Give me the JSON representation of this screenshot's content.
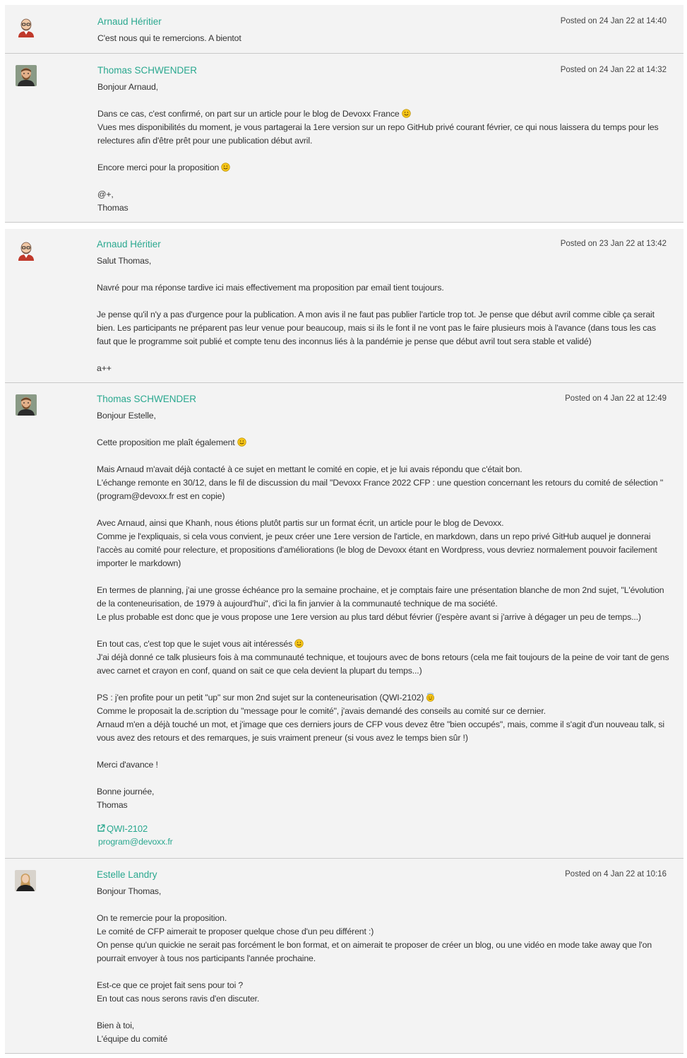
{
  "messages": [
    {
      "author": "Arnaud Héritier",
      "avatar_icon": "arnaud-avatar",
      "posted": "Posted on 24 Jan 22 at 14:40",
      "paragraphs": [
        "C'est nous qui te remercions. A bientot"
      ]
    },
    {
      "author": "Thomas SCHWENDER",
      "avatar_icon": "thomas-avatar",
      "posted": "Posted on 24 Jan 22 at 14:32",
      "paragraphs": [
        "Bonjour Arnaud,",
        "Dans ce cas, c'est confirmé, on part sur un article pour le blog de Devoxx France",
        "Vues mes disponibilités du moment, je vous partagerai la 1ere version sur un repo GitHub privé courant février, ce qui nous laissera du temps pour les relectures afin d'être prêt pour une publication début avril.",
        "Encore merci pour la proposition",
        "@+,\nThomas"
      ]
    },
    {
      "author": "Arnaud Héritier",
      "avatar_icon": "arnaud-avatar",
      "posted": "Posted on 23 Jan 22 at 13:42",
      "paragraphs": [
        "Salut Thomas,",
        "Navré pour ma réponse tardive ici mais effectivement ma proposition par email tient toujours.",
        "Je pense qu'il n'y a pas d'urgence pour la publication. A mon avis il ne faut pas publier l'article trop tot. Je pense que début avril comme cible ça serait bien. Les participants ne préparent pas leur venue pour beaucoup, mais si ils le font il ne vont pas le faire plusieurs mois à l'avance (dans tous les cas faut que le programme soit publié et compte tenu des inconnus liés à la pandémie je pense que début avril tout sera stable et validé)",
        "a++"
      ]
    },
    {
      "author": "Thomas SCHWENDER",
      "avatar_icon": "thomas-avatar",
      "posted": "Posted on 4 Jan 22 at 12:49",
      "paragraphs": [
        "Bonjour Estelle,",
        "Cette proposition me plaît également",
        "Mais Arnaud m'avait déjà contacté à ce sujet en mettant le comité en copie, et je lui avais répondu que c'était bon.\nL'échange remonte en 30/12, dans le fil de discussion du mail \"Devoxx France 2022 CFP : une question concernant les retours du comité de sélection \" (program@devoxx.fr est en copie)",
        "Avec Arnaud, ainsi que Khanh, nous étions plutôt partis sur un format écrit, un article pour le blog de Devoxx.\nComme je l'expliquais, si cela vous convient, je peux créer une 1ere version de l'article, en markdown, dans un repo privé GitHub auquel je donnerai l'accès au comité pour relecture, et propositions d'améliorations (le blog de Devoxx étant en Wordpress, vous devriez normalement pouvoir facilement importer le markdown)",
        "En termes de planning, j'ai une grosse échéance pro la semaine prochaine, et je comptais faire une présentation blanche de mon 2nd sujet, \"L'évolution de la conteneurisation, de 1979 à aujourd'hui\", d'ici la fin janvier à la communauté technique de ma société.\nLe plus probable est donc que je vous propose une 1ere version au plus tard début février (j'espère avant si j'arrive à dégager un peu de temps...)",
        "En tout cas, c'est top que le sujet vous ait intéressés",
        "J'ai déjà donné ce talk plusieurs fois à ma communauté technique, et toujours avec de bons retours (cela me fait toujours de la peine de voir tant de gens avec carnet et crayon en conf, quand on sait ce que cela devient la plupart du temps...)",
        "PS : j'en profite pour un petit \"up\" sur mon 2nd sujet sur la conteneurisation (QWI-2102)",
        "Comme le proposait la de.scription du \"message pour le comité\", j'avais demandé des conseils au comité sur ce dernier.\nArnaud m'en a déjà touché un mot, et j'image que ces derniers jours de CFP vous devez être \"bien occupés\", mais, comme il s'agit d'un nouveau talk, si vous avez des retours et des remarques, je suis vraiment preneur (si vous avez le temps bien sûr !)",
        "Merci d'avance !",
        "Bonne journée,\nThomas"
      ],
      "links": [
        "QWI-2102",
        "program@devoxx.fr"
      ]
    },
    {
      "author": "Estelle Landry",
      "avatar_icon": "estelle-avatar",
      "posted": "Posted on 4 Jan 22 at 10:16",
      "paragraphs": [
        "Bonjour Thomas,",
        "On te remercie pour la proposition.\nLe comité de CFP aimerait te proposer quelque chose d'un peu différent :)\nOn pense qu'un quickie ne serait pas forcément le bon format, et on aimerait te proposer de créer un blog, ou une vidéo en mode take away que l'on pourrait envoyer à tous nos participants l'année prochaine.",
        "Est-ce que ce projet fait sens pour toi ?\nEn tout cas nous serons ravis d'en discuter.",
        "Bien à toi,\nL'équipe du comité"
      ]
    }
  ],
  "icons": {
    "smiley": "smiley-emoji-icon",
    "innocent": "innocent-emoji-icon",
    "external_link": "external-link-icon"
  },
  "colors": {
    "author": "#2aa88f",
    "card_background": "#f3f3f3",
    "text": "#333333"
  }
}
